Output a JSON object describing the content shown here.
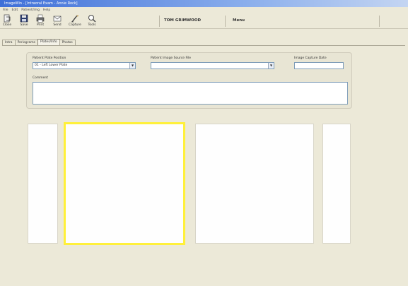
{
  "window": {
    "title": "ImageWin - [Intraoral Exam - Annie Rock]"
  },
  "menu": {
    "items": [
      "File",
      "Edit",
      "Patient/Img",
      "Help"
    ]
  },
  "toolbar": {
    "buttons": [
      {
        "id": "close",
        "label": "Close",
        "icon": "close-icon"
      },
      {
        "id": "save",
        "label": "Save",
        "icon": "save-icon"
      },
      {
        "id": "print",
        "label": "Print",
        "icon": "print-icon"
      },
      {
        "id": "send",
        "label": "Send",
        "icon": "send-icon"
      },
      {
        "id": "capture",
        "label": "Capture",
        "icon": "capture-icon"
      },
      {
        "id": "tools",
        "label": "Tools",
        "icon": "magnifier-icon"
      }
    ],
    "patient_name": "TOM GRIMWOOD",
    "pager_label": "Menu"
  },
  "tabs": [
    "Intra",
    "Periograms",
    "Plates/Info",
    "Photos"
  ],
  "active_tab": "Plates/Info",
  "form": {
    "plate_position_label": "Patient Plate Position",
    "plate_position_value": "01 - Left Lower Plate",
    "image_source_label": "Patient Image Source File",
    "image_source_value": "",
    "capture_date_label": "Image Capture Date",
    "capture_date_value": "",
    "comment_label": "Comment",
    "comment_value": ""
  },
  "image_frames": [
    {
      "name": "image-frame-1",
      "selected": false
    },
    {
      "name": "image-frame-2",
      "selected": true
    },
    {
      "name": "image-frame-3",
      "selected": false
    },
    {
      "name": "image-frame-4",
      "selected": false
    }
  ],
  "colors": {
    "window_bg": "#ECE9D8",
    "title_gradient_start": "#3E6FD8",
    "selection_highlight": "#FFF03A",
    "field_border": "#7F9DB9"
  }
}
